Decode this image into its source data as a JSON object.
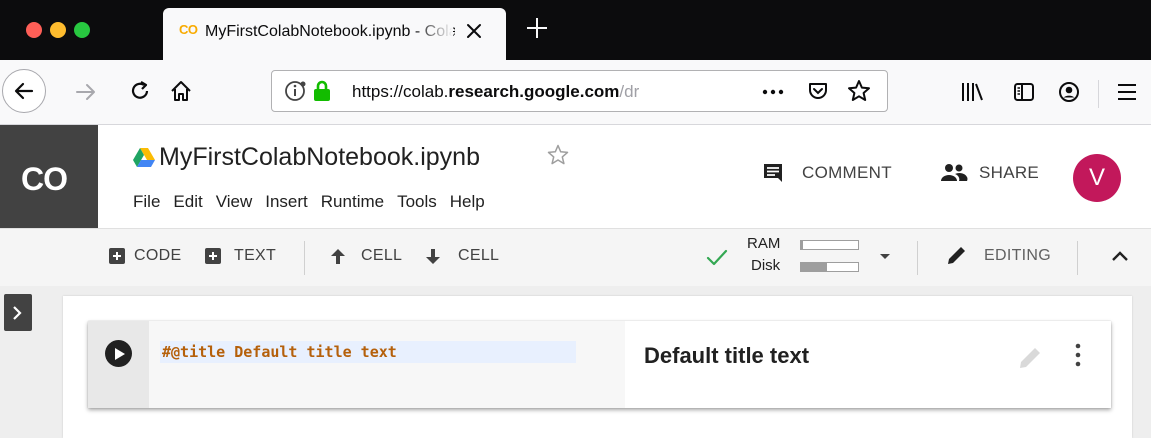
{
  "browser": {
    "tab_title": "MyFirstColabNotebook.ipynb - Colab",
    "tab_favicon": "CO",
    "url": {
      "prefix": "https://colab.",
      "host_bold": "research.google.com",
      "rest": "/dr"
    },
    "icons": [
      "back-icon",
      "forward-icon",
      "reload-icon",
      "home-icon",
      "info-icon",
      "lock-icon",
      "more-icon",
      "pocket-icon",
      "bookmark-star-icon",
      "library-icon",
      "sidebar-icon",
      "account-icon",
      "hamburger-menu-icon"
    ]
  },
  "colab": {
    "logo": "CO",
    "notebook_title": "MyFirstColabNotebook.ipynb",
    "menu": [
      "File",
      "Edit",
      "View",
      "Insert",
      "Runtime",
      "Tools",
      "Help"
    ],
    "comment_label": "COMMENT",
    "share_label": "SHARE",
    "avatar_letter": "V",
    "avatar_color": "#c2185b"
  },
  "toolbar": {
    "add_code": "CODE",
    "add_text": "TEXT",
    "cell_up": "CELL",
    "cell_down": "CELL",
    "ram_label": "RAM",
    "disk_label": "Disk",
    "ram_usage": 0.04,
    "disk_usage": 0.45,
    "editing_label": "EDITING",
    "connected_color": "#34a853"
  },
  "cell": {
    "code": "#@title Default title text",
    "form_title": "Default title text"
  }
}
